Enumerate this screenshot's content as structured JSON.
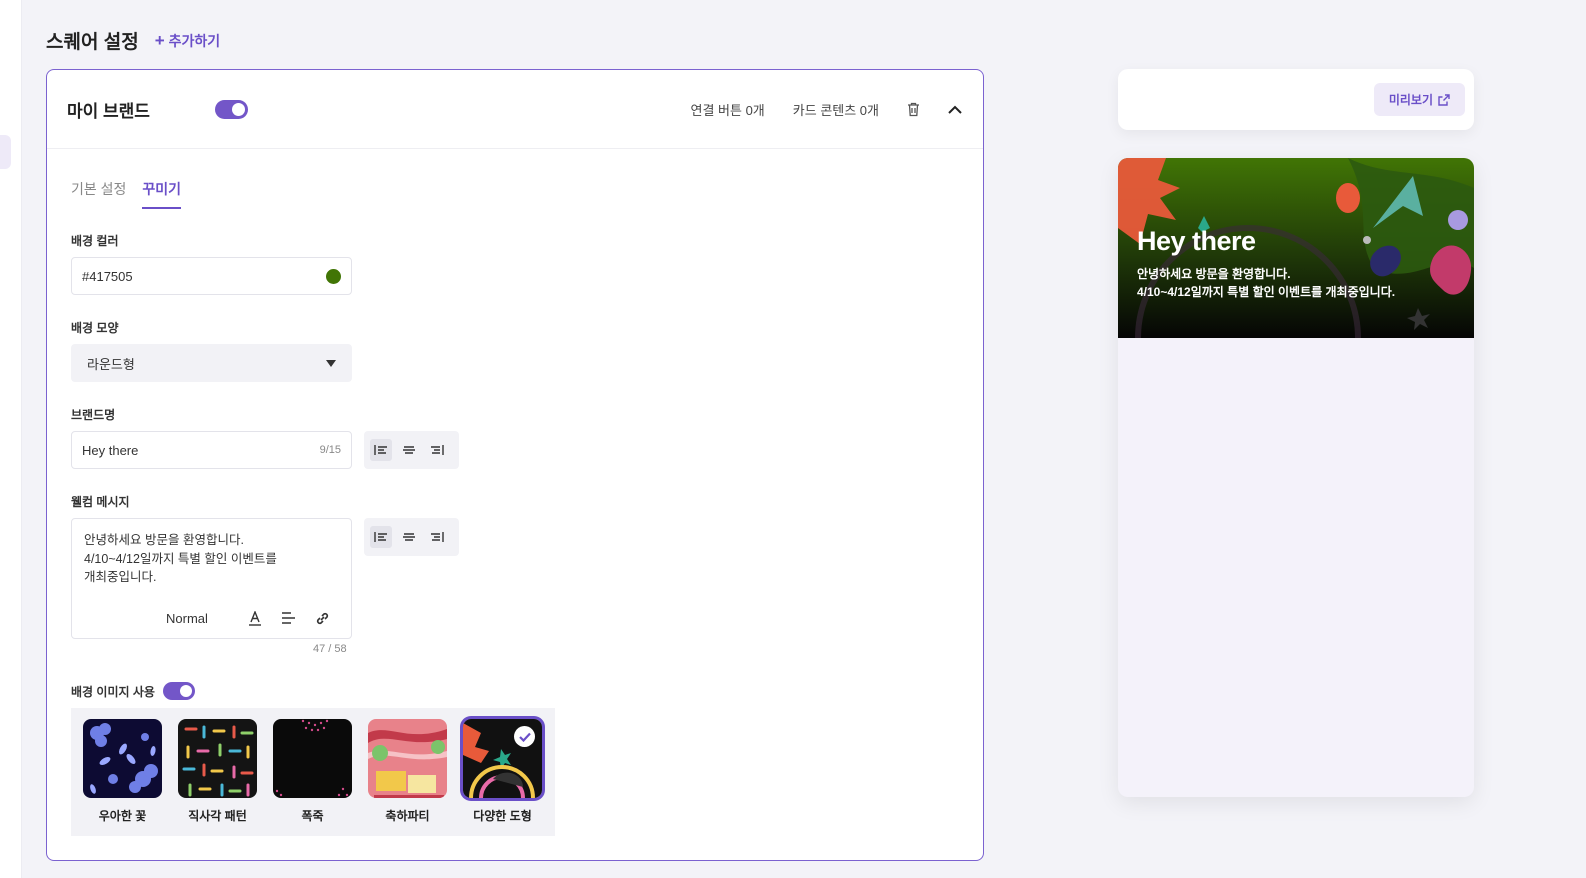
{
  "header": {
    "title": "스퀘어 설정",
    "add_label": "추가하기"
  },
  "card": {
    "brand_title": "마이 브랜드",
    "linked_buttons": "연결 버튼 0개",
    "card_contents": "카드 콘텐츠 0개",
    "enabled": true
  },
  "tabs": [
    {
      "label": "기본 설정",
      "active": false
    },
    {
      "label": "꾸미기",
      "active": true
    }
  ],
  "form": {
    "bg_color_label": "배경 컬러",
    "bg_color_value": "#417505",
    "bg_shape_label": "배경 모양",
    "bg_shape_value": "라운드형",
    "brand_name_label": "브랜드명",
    "brand_name_value": "Hey there",
    "brand_name_count": "9/15",
    "welcome_label": "웰컴 메시지",
    "welcome_text": "안녕하세요 방문을 환영합니다.\n4/10~4/12일까지 특별 할인 이벤트를\n개최중입니다.",
    "welcome_format": "Normal",
    "welcome_count": "47 / 58",
    "bg_image_label": "배경 이미지 사용",
    "bg_image_enabled": true
  },
  "thumbnails": [
    {
      "label": "우아한 꽃",
      "selected": false
    },
    {
      "label": "직사각 패턴",
      "selected": false
    },
    {
      "label": "폭죽",
      "selected": false
    },
    {
      "label": "축하파티",
      "selected": false
    },
    {
      "label": "다양한 도형",
      "selected": true
    }
  ],
  "preview": {
    "button_label": "미리보기",
    "hero_title": "Hey there",
    "hero_message": "안녕하세요 방문을 환영합니다.\n4/10~4/12일까지 특별 할인 이벤트를 개최중입니다."
  },
  "colors": {
    "accent": "#6a4fc8",
    "bg_color": "#417505"
  },
  "icons": [
    "plus-icon",
    "trash-icon",
    "chevron-up-icon",
    "align-left-icon",
    "align-center-icon",
    "align-right-icon",
    "caret-down-icon",
    "text-color-icon",
    "align-icon",
    "link-icon",
    "check-icon",
    "external-link-icon"
  ]
}
